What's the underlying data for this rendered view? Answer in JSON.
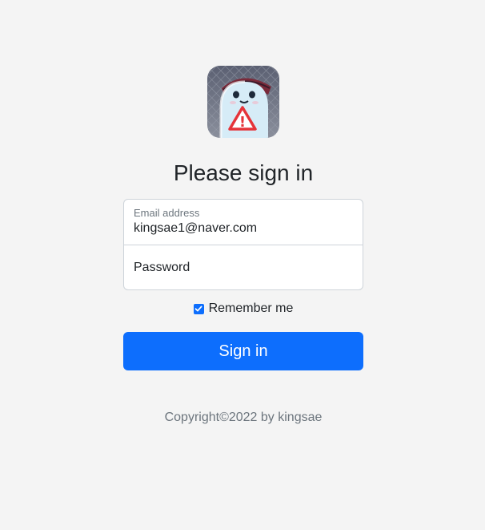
{
  "logo": {
    "icon": "ghost-character-warning-icon",
    "warning_mark": "!"
  },
  "title": "Please sign in",
  "email": {
    "label": "Email address",
    "value": "kingsae1@naver.com"
  },
  "password": {
    "label": "Password"
  },
  "remember": {
    "label": "Remember me",
    "checked": true
  },
  "submit_label": "Sign in",
  "copyright": "Copyright©2022 by kingsae",
  "colors": {
    "background": "#f4f4f4",
    "primary": "#0d6efd",
    "text": "#212529",
    "muted": "#6c757d",
    "border": "#ced4da"
  }
}
